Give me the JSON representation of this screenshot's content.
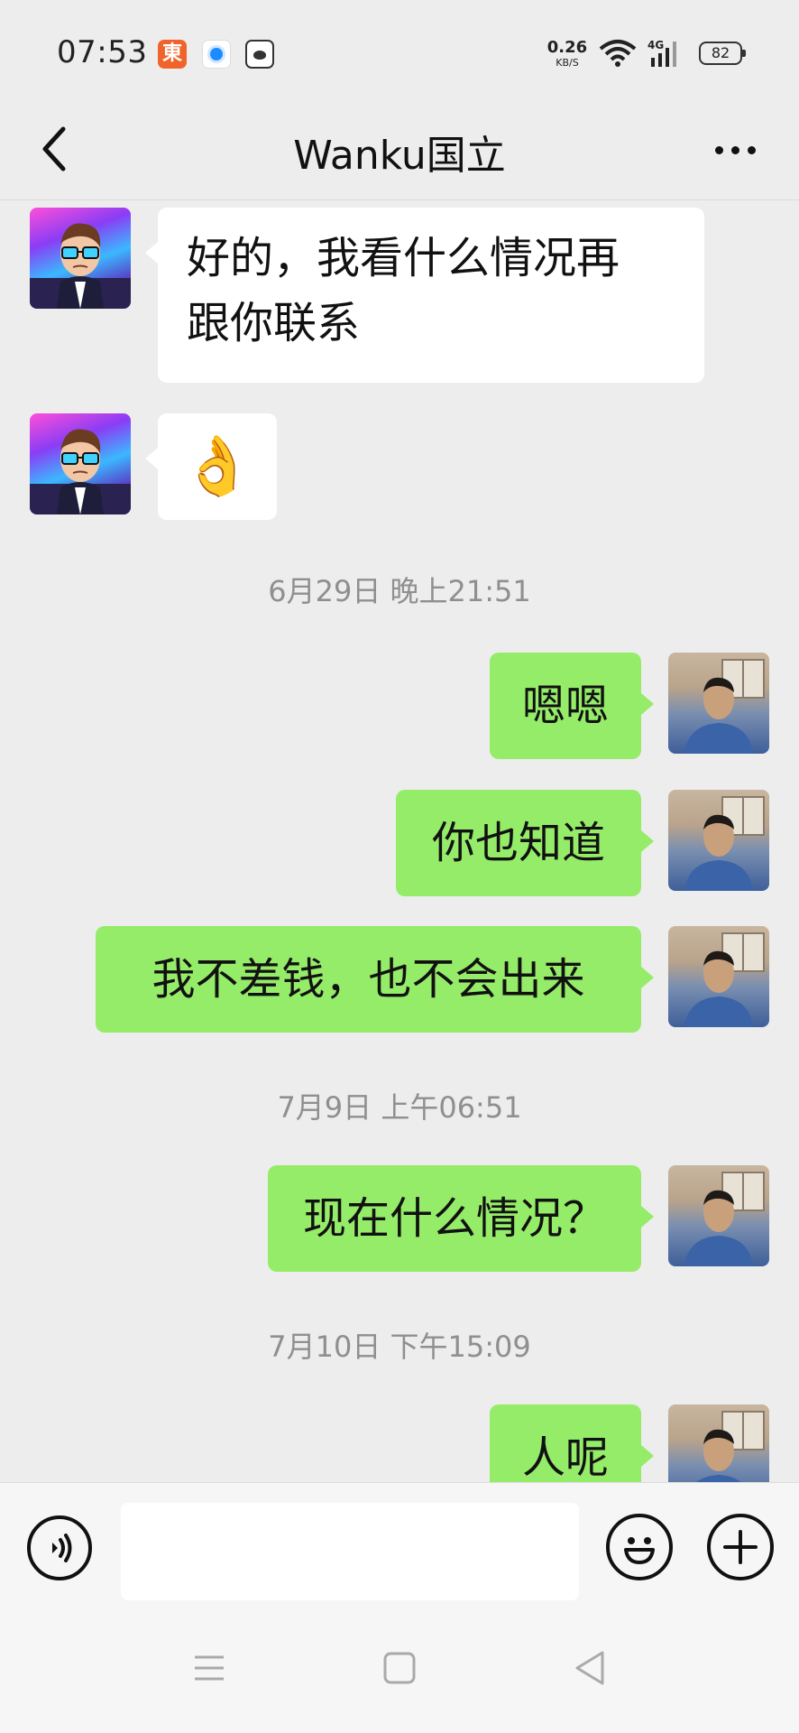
{
  "status_bar": {
    "time": "07:53",
    "app_icon_1": "東",
    "net_speed_value": "0.26",
    "net_speed_unit": "KB/S",
    "signal_label": "4G",
    "battery": "82"
  },
  "header": {
    "title": "Wanku国立"
  },
  "messages": [
    {
      "side": "left",
      "text": "好的，我看什么情况再\n跟你联系"
    },
    {
      "side": "left",
      "text": "👌"
    },
    {
      "side": "timestamp",
      "text": "6月29日 晚上21:51"
    },
    {
      "side": "right",
      "text": "嗯嗯"
    },
    {
      "side": "right",
      "text": "你也知道"
    },
    {
      "side": "right",
      "text": "我不差钱，也不会出来"
    },
    {
      "side": "timestamp",
      "text": "7月9日 上午06:51"
    },
    {
      "side": "right",
      "text": "现在什么情况？"
    },
    {
      "side": "timestamp",
      "text": "7月10日 下午15:09"
    },
    {
      "side": "right",
      "text": "人呢"
    }
  ],
  "input_bar": {
    "value": ""
  },
  "icons": {
    "back": "chevron-left-icon",
    "more": "more-dots-icon",
    "voice": "voice-icon",
    "emoji": "smiley-icon",
    "plus": "plus-icon",
    "nav_menu": "menu-icon",
    "nav_home": "square-home-icon",
    "nav_back": "triangle-back-icon"
  },
  "colors": {
    "background": "#ededed",
    "sent_bubble": "#95ec69",
    "received_bubble": "#ffffff",
    "timestamp_text": "#8f8f8f"
  }
}
